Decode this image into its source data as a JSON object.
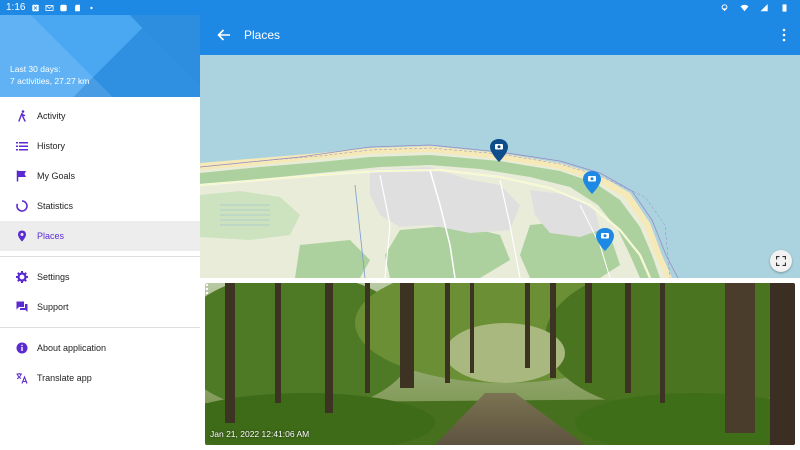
{
  "status_bar": {
    "time": "1:16"
  },
  "drawer": {
    "summary_line1": "Last 30 days:",
    "summary_line2": "7 activities, 27.27 km",
    "items": [
      {
        "label": "Activity",
        "icon": "walk-icon"
      },
      {
        "label": "History",
        "icon": "list-icon"
      },
      {
        "label": "My Goals",
        "icon": "flag-icon"
      },
      {
        "label": "Statistics",
        "icon": "progress-ring-icon"
      },
      {
        "label": "Places",
        "icon": "location-pin-icon",
        "active": true
      },
      {
        "label": "Settings",
        "icon": "gear-icon"
      },
      {
        "label": "Support",
        "icon": "forum-icon"
      },
      {
        "label": "About application",
        "icon": "info-icon"
      },
      {
        "label": "Translate app",
        "icon": "translate-icon"
      }
    ]
  },
  "app_bar": {
    "title": "Places"
  },
  "photo": {
    "timestamp": "Jan 21, 2022 12:41:06 AM"
  },
  "colors": {
    "primary": "#1e88e5",
    "accent": "#5b2ad3",
    "map_water": "#aad3df"
  }
}
